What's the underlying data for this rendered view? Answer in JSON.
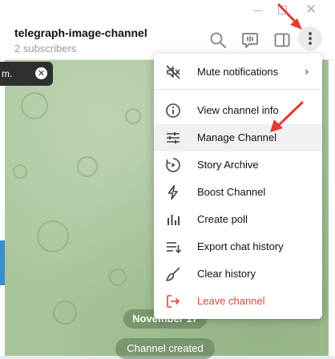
{
  "window": {
    "minimize_icon": "minimize-icon",
    "maximize_icon": "maximize-icon",
    "close_glyph": "✕"
  },
  "header": {
    "title": "telegraph-image-channel",
    "subtitle": "2 subscribers",
    "icons": [
      "search-icon",
      "video-chat-icon",
      "sidebar-toggle-icon",
      "more-vertical-icon"
    ]
  },
  "toast": {
    "text": "m.",
    "close_glyph": "✕"
  },
  "menu": {
    "top_item": {
      "label": "Mute notifications",
      "icon": "mute-icon",
      "chevron": "›"
    },
    "items": [
      {
        "label": "View channel info",
        "icon": "info-icon"
      },
      {
        "label": "Manage Channel",
        "icon": "sliders-icon"
      },
      {
        "label": "Story Archive",
        "icon": "story-archive-icon"
      },
      {
        "label": "Boost Channel",
        "icon": "bolt-icon"
      },
      {
        "label": "Create poll",
        "icon": "poll-icon"
      },
      {
        "label": "Export chat history",
        "icon": "export-icon"
      },
      {
        "label": "Clear history",
        "icon": "broom-icon"
      },
      {
        "label": "Leave channel",
        "icon": "leave-icon"
      }
    ]
  },
  "chat": {
    "date_label": "November 17",
    "service_message": "Channel created"
  },
  "colors": {
    "danger": "#e0443a",
    "annotation_arrow": "#e53935",
    "chat_background": "#a8c49a",
    "accent_blue": "#3a8ed6"
  }
}
